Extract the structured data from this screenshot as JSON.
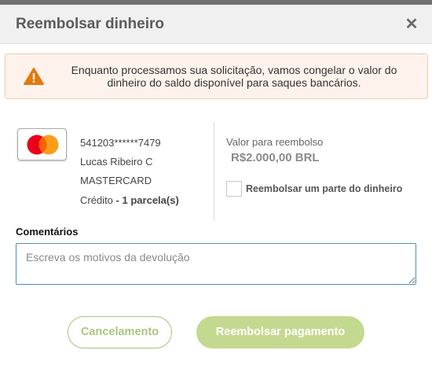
{
  "modal": {
    "title": "Reembolsar dinheiro",
    "close_icon": "close-icon"
  },
  "alert": {
    "icon": "warning-icon",
    "text": "Enquanto processamos sua solicitação, vamos congelar o valor do dinheiro do saldo disponível para saques bancários."
  },
  "card": {
    "logo_icon": "mastercard-logo",
    "number": "541203******7479",
    "holder": "Lucas Ribeiro C",
    "brand": "MASTERCARD",
    "payment_type": "Crédito",
    "installments_sep": "-",
    "installments": "1 parcela(s)"
  },
  "refund": {
    "amount_label": "Valor para reembolso",
    "amount": "R$2.000,00 BRL",
    "partial_label": "Reembolsar um parte do dinheiro",
    "partial_checked": false
  },
  "comments": {
    "label": "Comentários",
    "placeholder": "Escreva os motivos da devolução",
    "value": ""
  },
  "actions": {
    "cancel_label": "Cancelamento",
    "submit_label": "Reembolsar pagamento"
  },
  "colors": {
    "alert_bg": "#fdf3ec",
    "warning": "#e4790e",
    "accent_green": "#c4d990",
    "input_border": "#4a8fc4"
  }
}
